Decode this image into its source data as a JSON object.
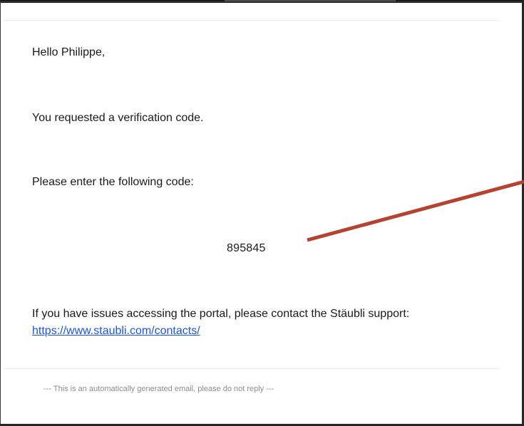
{
  "email": {
    "greeting": "Hello Philippe,",
    "requested_text": "You requested a verification code.",
    "enter_code_text": "Please enter the following code:",
    "verification_code": "895845",
    "support_text": "If you have issues accessing the portal, please contact the Stäubli support:",
    "support_link": "https://www.staubli.com/contacts/",
    "footer_note": "--- This is an automatically generated email, please do not reply ---"
  },
  "colors": {
    "link": "#1a56db",
    "annotation_arrow": "#b5432f",
    "footer_text": "#8c8c8c"
  }
}
